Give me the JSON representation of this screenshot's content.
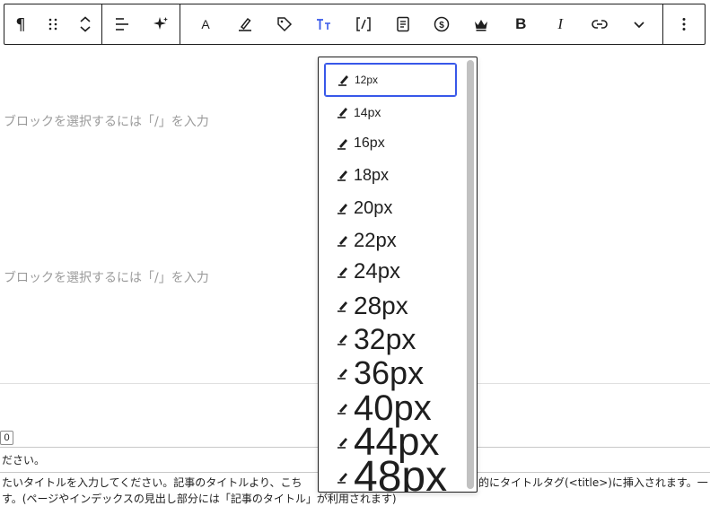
{
  "toolbar": {
    "paragraph_glyph": "¶",
    "bold_glyph": "B",
    "italic_glyph": "I",
    "highlight_glyph": "A"
  },
  "editor": {
    "placeholder_1": "ブロックを選択するには「/」を入力",
    "placeholder_2": "ブロックを選択するには「/」を入力"
  },
  "meta": {
    "counter": "0",
    "line_1": "ださい。",
    "line_2a": "たいタイトルを入力してください。記事のタイトルより、こち",
    "line_2b": "的にタイトルタグ(<title>)に挿入されます。一",
    "line_3": "す。(ページやインデックスの見出し部分には「記事のタイトル」が利用されます)"
  },
  "font_size_menu": {
    "items": [
      {
        "label": "12px",
        "size": 12,
        "selected": true
      },
      {
        "label": "14px",
        "size": 14,
        "selected": false
      },
      {
        "label": "16px",
        "size": 16,
        "selected": false
      },
      {
        "label": "18px",
        "size": 18,
        "selected": false
      },
      {
        "label": "20px",
        "size": 20,
        "selected": false
      },
      {
        "label": "22px",
        "size": 22,
        "selected": false
      },
      {
        "label": "24px",
        "size": 24,
        "selected": false
      },
      {
        "label": "28px",
        "size": 28,
        "selected": false
      },
      {
        "label": "32px",
        "size": 32,
        "selected": false
      },
      {
        "label": "36px",
        "size": 36,
        "selected": false
      },
      {
        "label": "40px",
        "size": 40,
        "selected": false
      },
      {
        "label": "44px",
        "size": 44,
        "selected": false
      },
      {
        "label": "48px",
        "size": 48,
        "selected": false
      }
    ]
  },
  "colors": {
    "accent": "#3858e9",
    "border": "#1e1e1e",
    "placeholder": "#9b9b9b"
  },
  "icons": {
    "paragraph": "paragraph-icon",
    "drag": "drag-handle-icon",
    "move": "move-up-down-icon",
    "align": "align-left-icon",
    "ai": "sparkle-icon",
    "highlight": "text-color-icon",
    "marker": "marker-icon",
    "tag": "tag-icon",
    "font_size": "font-size-icon",
    "code": "inline-code-icon",
    "note": "note-icon",
    "dollar": "dollar-icon",
    "crown": "crown-icon",
    "link": "link-icon",
    "more_rich": "chevron-down-icon",
    "options": "more-vertical-icon",
    "menu_item": "pen-icon"
  }
}
